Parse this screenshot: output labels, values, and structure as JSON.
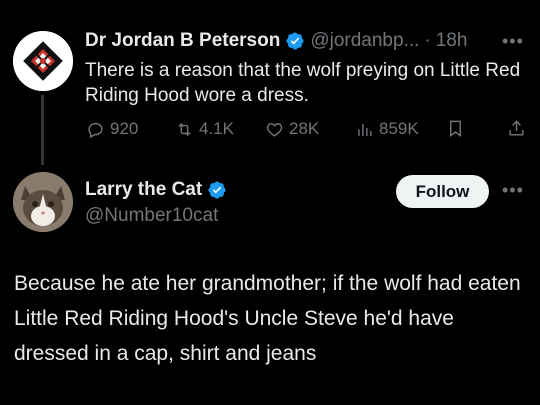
{
  "parent_tweet": {
    "display_name": "Dr Jordan B Peterson",
    "handle": "@jordanbp...",
    "separator": "·",
    "time": "18h",
    "text": "There is a reason that the wolf preying on Little Red Riding Hood wore a dress.",
    "stats": {
      "replies": "920",
      "retweets": "4.1K",
      "likes": "28K",
      "views": "859K"
    },
    "avatar_icon": "maps-of-meaning-logo",
    "verified_icon": "verified-badge-icon"
  },
  "reply": {
    "display_name": "Larry the Cat",
    "handle": "@Number10cat",
    "follow_label": "Follow",
    "text": "Because he ate her grandmother; if the wolf had eaten Little Red Riding Hood's Uncle Steve he'd have dressed in a cap, shirt and jeans",
    "avatar_icon": "cat-photo-avatar"
  },
  "colors": {
    "background": "#000000",
    "primary_text": "#e7e9ea",
    "secondary_text": "#71767b",
    "verified_blue": "#1d9bf0",
    "follow_button": "#eff3f4"
  }
}
